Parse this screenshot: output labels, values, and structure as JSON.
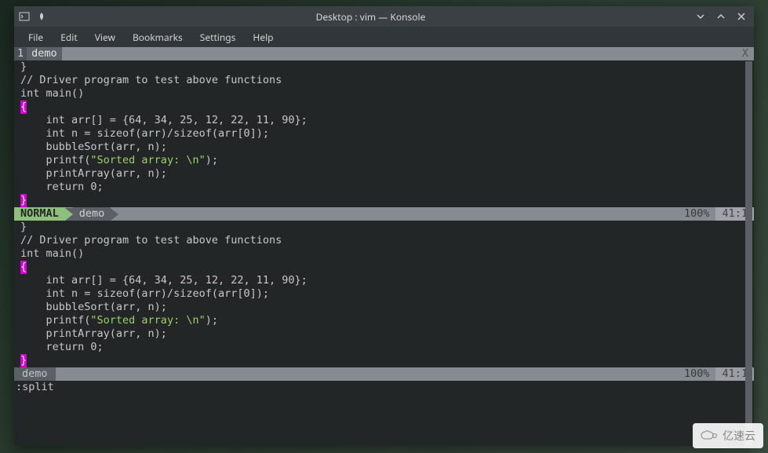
{
  "window": {
    "title": "Desktop : vim — Konsole"
  },
  "menubar": {
    "items": [
      "File",
      "Edit",
      "View",
      "Bookmarks",
      "Settings",
      "Help"
    ]
  },
  "tab": {
    "number": "1",
    "name": "demo",
    "close": "X"
  },
  "code": {
    "l0": "}",
    "l1": "",
    "l2": "// Driver program to test above functions",
    "l3": "int main()",
    "l4_brace": "{",
    "l5": "    int arr[] = {64, 34, 25, 12, 22, 11, 90};",
    "l6": "    int n = sizeof(arr)/sizeof(arr[0]);",
    "l7": "    bubbleSort(arr, n);",
    "l8a": "    printf(",
    "l8b": "\"Sorted array: \\n\"",
    "l8c": ");",
    "l9": "    printArray(arr, n);",
    "l10": "    return 0;",
    "l11_brace": "}"
  },
  "status1": {
    "mode": "NORMAL",
    "file": "demo",
    "percent": "100%",
    "pos": "41:1"
  },
  "status2": {
    "file": "demo",
    "percent": "100%",
    "pos": "41:1"
  },
  "cmdline": ":split",
  "watermark": "亿速云"
}
